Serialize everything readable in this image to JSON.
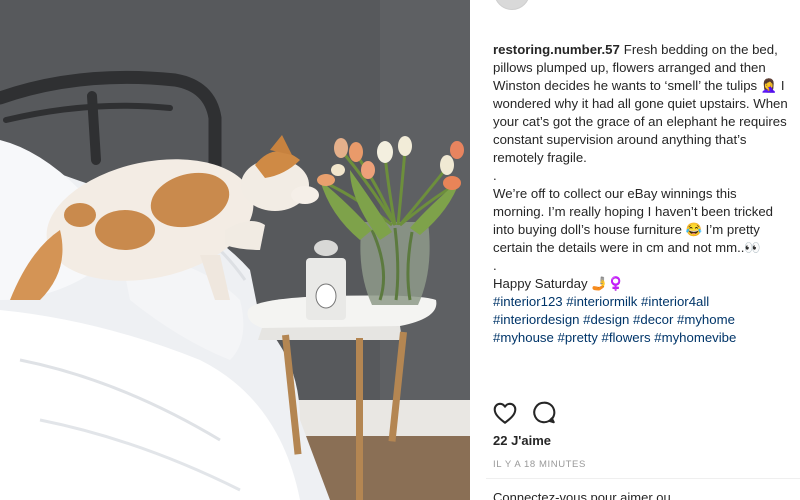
{
  "post": {
    "username": "restoring.number.57",
    "paragraph1": "Fresh bedding on the bed, pillows plumped up, flowers arranged and then Winston decides he wants to ‘smell’ the tulips 🤦‍♀️ I wondered why it had all gone quiet upstairs. When your cat’s got the grace of an elephant he requires constant supervision around anything that’s remotely fragile.",
    "dot1": ".",
    "paragraph2": "We’re off to collect our eBay winnings this morning. I’m really hoping I haven’t been tricked into buying doll’s house furniture 😂 I’m pretty certain the details were in cm and not mm..👀",
    "dot2": ".",
    "paragraph3": "Happy Saturday 🤳♀️",
    "hashtags": "#interior123 #interiormilk #interior4all #interiordesign #design #decor #myhome #myhouse #pretty #flowers #myhomevibe",
    "likes": "22 J'aime",
    "time": "IL Y A 18 MINUTES",
    "login_prompt": "Connectez-vous pour aimer ou"
  },
  "icons": {
    "like": "heart-icon",
    "comment": "comment-icon"
  },
  "colors": {
    "wall": "#55575a",
    "hashtag": "#003569",
    "text": "#262626",
    "meta": "#999999"
  }
}
